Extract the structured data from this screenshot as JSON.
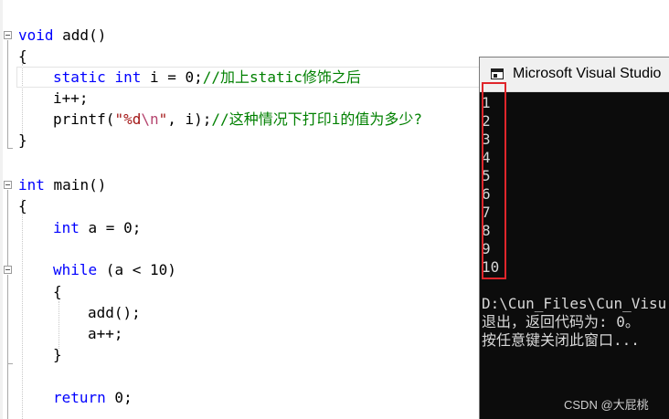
{
  "editor": {
    "lines": {
      "l1": {
        "kw": "void",
        "rest": " add()"
      },
      "l2": "{",
      "l3": {
        "kw1": "static",
        "sp1": " ",
        "kw2": "int",
        "code": " i = 0;",
        "comment": "//加上static修饰之后"
      },
      "l4": "i++;",
      "l5": {
        "fn": "printf(",
        "str_open": "\"%d",
        "esc": "\\n",
        "str_close": "\"",
        "rest": ", i);",
        "comment": "//这种情况下打印i的值为多少?"
      },
      "l6": "}",
      "l7": {
        "kw": "int",
        "rest": " main()"
      },
      "l8": "{",
      "l9": {
        "kw": "int",
        "rest": " a = 0;"
      },
      "l10": {
        "kw": "while",
        "rest": " (a < 10)"
      },
      "l11": "{",
      "l12": "add();",
      "l13": "a++;",
      "l14": "}",
      "l15": {
        "kw": "return",
        "rest": " 0;"
      }
    }
  },
  "console": {
    "title": "Microsoft Visual Studio",
    "output": [
      "1",
      "2",
      "3",
      "4",
      "5",
      "6",
      "7",
      "8",
      "9",
      "10"
    ],
    "path_line": "D:\\Cun_Files\\Cun_Visu",
    "exit_line": "退出，返回代码为: 0。",
    "prompt_line": "按任意键关闭此窗口...",
    "watermark": "CSDN @大屁桃"
  },
  "colors": {
    "keyword": "#0000ff",
    "comment": "#008000",
    "string": "#a31515",
    "console_bg": "#0c0c0c",
    "highlight": "#e0262b"
  }
}
